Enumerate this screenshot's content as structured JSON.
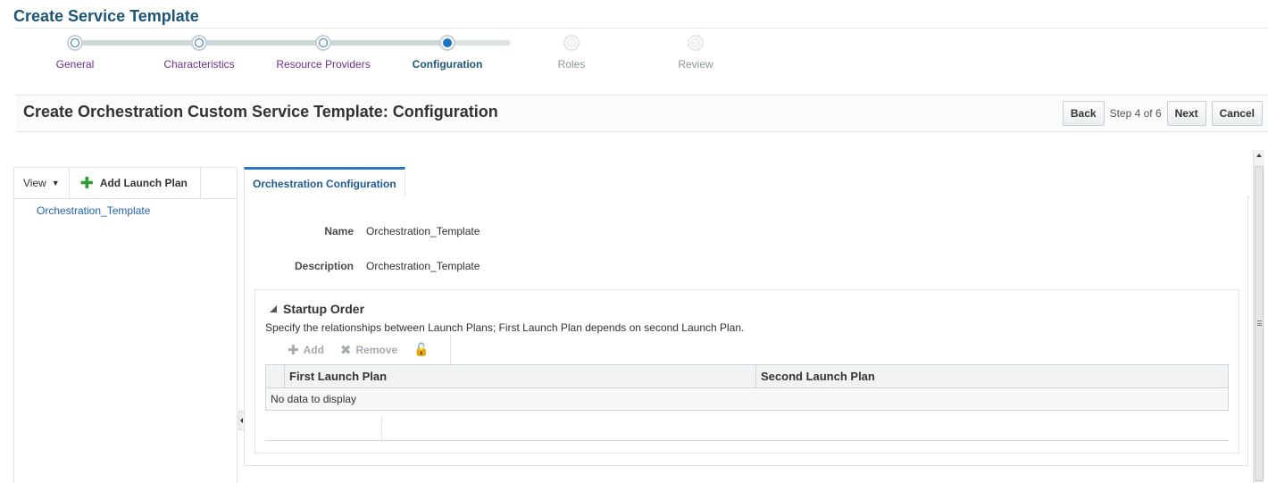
{
  "page": {
    "title": "Create Service Template"
  },
  "train": {
    "steps": [
      {
        "label": "General",
        "state": "done"
      },
      {
        "label": "Characteristics",
        "state": "done"
      },
      {
        "label": "Resource Providers",
        "state": "done"
      },
      {
        "label": "Configuration",
        "state": "current"
      },
      {
        "label": "Roles",
        "state": "future"
      },
      {
        "label": "Review",
        "state": "future"
      }
    ]
  },
  "header": {
    "title": "Create Orchestration Custom Service Template: Configuration",
    "back_label": "Back",
    "step_text": "Step 4 of 6",
    "next_label": "Next",
    "cancel_label": "Cancel"
  },
  "left_panel": {
    "view_label": "View",
    "add_launch_plan_label": "Add Launch Plan",
    "tree_items": [
      "Orchestration_Template"
    ]
  },
  "tabs": [
    {
      "label": "Orchestration Configuration",
      "selected": true
    }
  ],
  "form": {
    "name_label": "Name",
    "name_value": "Orchestration_Template",
    "description_label": "Description",
    "description_value": "Orchestration_Template"
  },
  "startup_order": {
    "title": "Startup Order",
    "description": "Specify the relationships between Launch Plans; First Launch Plan depends on second Launch Plan.",
    "toolbar": {
      "add_label": "Add",
      "remove_label": "Remove"
    },
    "columns": [
      "First Launch Plan",
      "Second Launch Plan"
    ],
    "empty_text": "No data to display"
  },
  "icons": {
    "add_launch_plan": "plus-icon",
    "view_menu": "caret-down-icon",
    "add": "plus-icon",
    "remove": "x-icon",
    "detach": "lock-icon",
    "collapse": "triangle-icon"
  },
  "colors": {
    "title_blue": "#1d5578",
    "visited_step": "#6d2f8a",
    "current_step": "#1a72c2",
    "link_blue": "#1f62ae",
    "tab_accent": "#2a78c4",
    "plus_green": "#2f9d2f"
  }
}
